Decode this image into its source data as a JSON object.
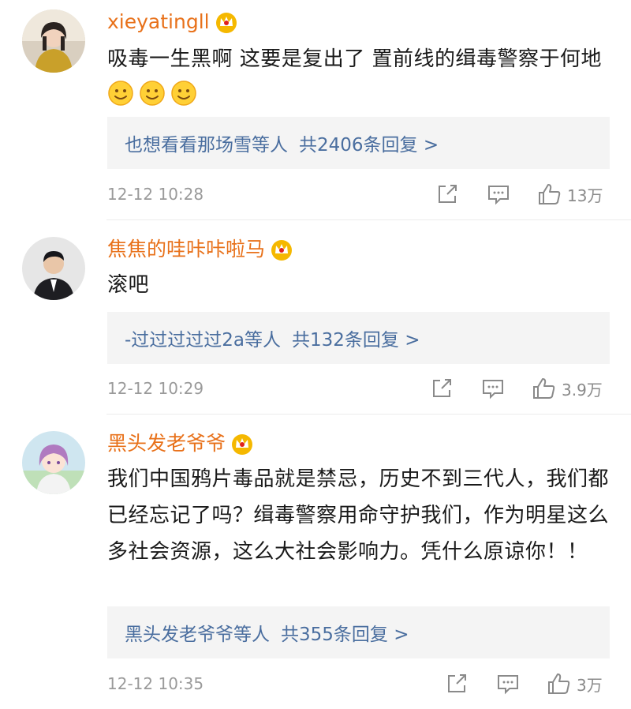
{
  "comments": [
    {
      "username": "xieyatingll",
      "text": "吸毒一生黑啊 这要是复出了 置前线的缉毒警察于何地",
      "emoji_count": 3,
      "reply_names": "也想看看那场雪等人",
      "reply_count": "共2406条回复 >",
      "time": "12-12 10:28",
      "likes": "13万"
    },
    {
      "username": "焦焦的哇咔咔啦马",
      "text": "滚吧",
      "reply_names": "-过过过过过2a等人",
      "reply_count": "共132条回复 >",
      "time": "12-12 10:29",
      "likes": "3.9万"
    },
    {
      "username": "黑头发老爷爷",
      "text": "我们中国鸦片毒品就是禁忌，历史不到三代人，我们都已经忘记了吗？缉毒警察用命守护我们，作为明星这么多社会资源，这么大社会影响力。凭什么原谅你！！",
      "reply_names": "黑头发老爷爷等人",
      "reply_count": "共355条回复 >",
      "time": "12-12 10:35",
      "likes": "3万"
    }
  ],
  "icons": {
    "avatar": "avatar-icon",
    "crown": "crown-badge-icon",
    "emoji": "smile-emoji-icon",
    "share": "share-icon",
    "comment": "comment-icon",
    "like": "thumbs-up-icon"
  },
  "colors": {
    "username": "#e8711a",
    "reply_link": "#4a6e9f",
    "reply_bg": "#f4f4f4",
    "meta_text": "#9a9a9a"
  }
}
